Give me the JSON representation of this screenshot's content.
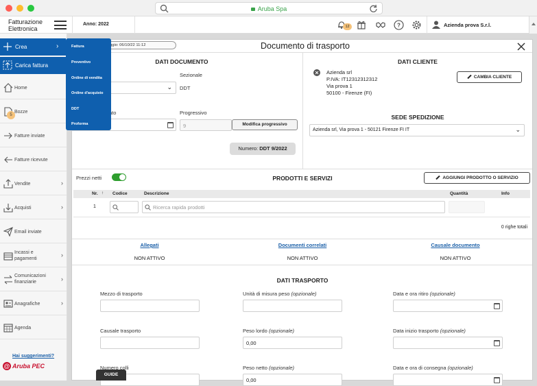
{
  "browser": {
    "url_text": "Aruba Spa"
  },
  "header": {
    "app_title_line1": "Fatturazione",
    "app_title_line2": "Elettronica",
    "year_label": "Anno: 2022",
    "notification_count": "12",
    "company": "Azienda prova S.r.l."
  },
  "sidebar": {
    "create_label": "Crea",
    "upload_label": "Carica fattura",
    "items": [
      {
        "label": "Home"
      },
      {
        "label": "Bozze",
        "badge": "5"
      },
      {
        "label": "Fatture inviate"
      },
      {
        "label": "Fatture ricevute"
      },
      {
        "label": "Vendite"
      },
      {
        "label": "Acquisti"
      },
      {
        "label": "Email inviate"
      },
      {
        "label": "Incassi e pagamenti"
      },
      {
        "label": "Comunicazioni finanziarie"
      },
      {
        "label": "Anagrafiche"
      },
      {
        "label": "Agenda"
      }
    ],
    "suggestions": "Hai suggerimenti?",
    "brand": "Aruba PEC"
  },
  "popup_menu": [
    "Fattura",
    "Preventivo",
    "Ordine di vendita",
    "Ordine d'acquisto",
    "DDT",
    "Proforma"
  ],
  "dialog": {
    "tag": "ggio: 06/10/22 11:12",
    "title": "Documento di trasporto",
    "doc": {
      "section_title": "DATI DOCUMENTO",
      "sezionale_label": "Sezionale",
      "sezionale_value": "DDT",
      "date_label_fragment": "ato",
      "progressivo_label": "Progressivo",
      "progressivo_value": "9",
      "modify_button": "Modifica progressivo",
      "number_prefix": "Numero: ",
      "number_value": "DDT 9/2022"
    },
    "client": {
      "section_title": "DATI CLIENTE",
      "name": "Azienda srl",
      "piva": "P.IVA: IT12312312312",
      "street": "Via prova 1",
      "city": "50100 - Firenze (FI)",
      "change_button": "CAMBIA CLIENTE",
      "shipping_title": "SEDE SPEDIZIONE",
      "shipping_value": "Azienda srl, Via prova 1  - 50121 Firenze FI IT"
    },
    "products": {
      "net_prices_label": "Prezzi netti",
      "section_title": "PRODOTTI E SERVIZI",
      "add_button": "AGGIUNGI PRODOTTO O SERVIZIO",
      "columns": {
        "nr": "Nr.",
        "code": "Codice",
        "desc": "Descrizione",
        "qty": "Quantità",
        "info": "Info"
      },
      "row_nr": "1",
      "search_placeholder": "Ricerca rapida prodotti",
      "totals": "0 righe totali"
    },
    "attachments": [
      {
        "label": "Allegati",
        "status": "NON ATTIVO"
      },
      {
        "label": "Documenti correlati",
        "status": "NON ATTIVO"
      },
      {
        "label": "Causale documento",
        "status": "NON ATTIVO"
      }
    ],
    "transport": {
      "section_title": "DATI TRASPORTO",
      "mezzo": "Mezzo di trasporto",
      "unita_prefix": "Unità di misura peso ",
      "opt": "(opzionale)",
      "ritiro_prefix": "Data e ora ritiro ",
      "causale": "Causale trasporto",
      "lordo_prefix": "Peso lordo ",
      "lordo_value": "0,00",
      "inizio_prefix": "Data inizio trasporto ",
      "colli": "Numero colli",
      "netto_prefix": "Peso netto ",
      "netto_value": "0,00",
      "consegna_prefix": "Data e ora di consegna "
    }
  },
  "guide_label": "GUIDE",
  "colors": {
    "brand_blue": "#0f5fae",
    "toggle_green": "#2e9e2e",
    "link_blue": "#1a5fa8",
    "badge_orange": "#f5c27a",
    "brand_red": "#c8102e"
  }
}
